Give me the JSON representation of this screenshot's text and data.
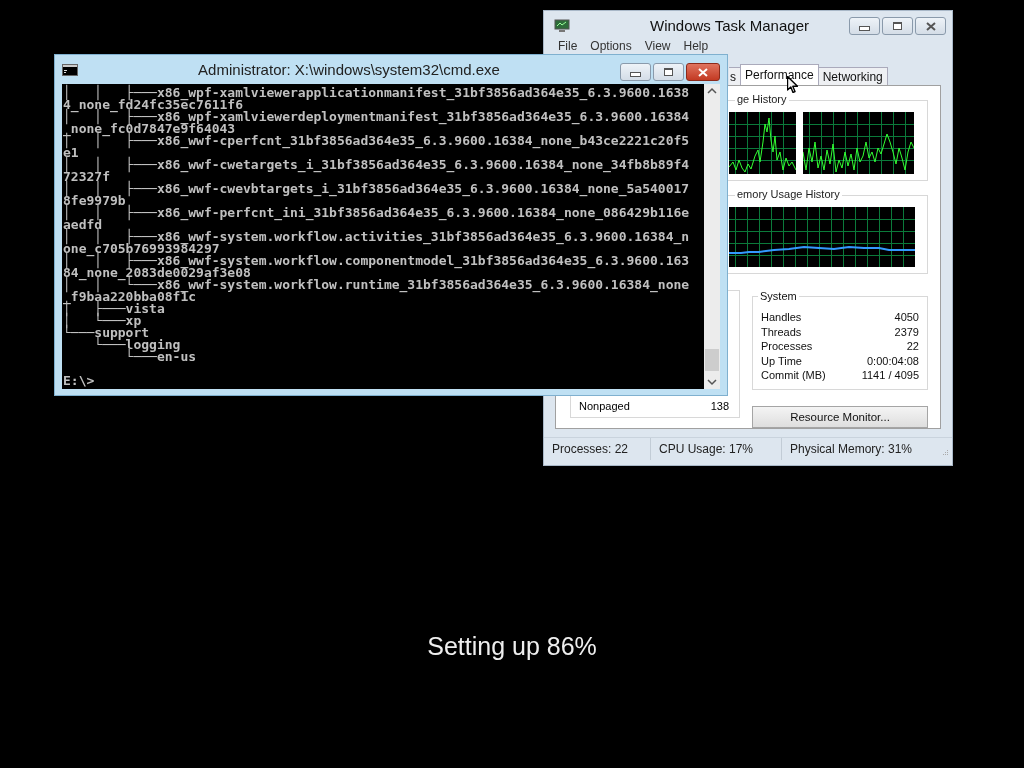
{
  "task_manager": {
    "title": "Windows Task Manager",
    "menu": [
      "File",
      "Options",
      "View",
      "Help"
    ],
    "tabs": [
      {
        "label": "s",
        "selected": false
      },
      {
        "label": "Performance",
        "selected": true
      },
      {
        "label": "Networking",
        "selected": false
      }
    ],
    "cpu_history": {
      "label": "ge History"
    },
    "memory_history": {
      "label": "emory Usage History"
    },
    "physical_memory": {
      "rows": [
        {
          "label": "Nonpaged",
          "value": "138"
        }
      ]
    },
    "system": {
      "title": "System",
      "rows": [
        {
          "label": "Handles",
          "value": "4050"
        },
        {
          "label": "Threads",
          "value": "2379"
        },
        {
          "label": "Processes",
          "value": "22"
        },
        {
          "label": "Up Time",
          "value": "0:00:04:08"
        },
        {
          "label": "Commit (MB)",
          "value": "1141 / 4095"
        }
      ]
    },
    "resource_monitor_button": "Resource Monitor...",
    "status_bar": [
      "Processes: 22",
      "CPU Usage: 17%",
      "Physical Memory: 31%"
    ]
  },
  "console": {
    "title": "Administrator: X:\\windows\\system32\\cmd.exe",
    "lines": [
      "│   │   ├───x86_wpf-xamlviewerapplicationmanifest_31bf3856ad364e35_6.3.9600.1638",
      "4_none_fd24fc35ec7611f6",
      "│   │   ├───x86_wpf-xamlviewerdeploymentmanifest_31bf3856ad364e35_6.3.9600.16384",
      "_none_fc0d7847e9f64043",
      "│   │   ├───x86_wwf-cperfcnt_31bf3856ad364e35_6.3.9600.16384_none_b43ce2221c20f5",
      "e1",
      "│   │   ├───x86_wwf-cwetargets_i_31bf3856ad364e35_6.3.9600.16384_none_34fb8b89f4",
      "72327f",
      "│   │   ├───x86_wwf-cwevbtargets_i_31bf3856ad364e35_6.3.9600.16384_none_5a540017",
      "8fe9979b",
      "│   │   ├───x86_wwf-perfcnt_ini_31bf3856ad364e35_6.3.9600.16384_none_086429b116e",
      "aedfd",
      "│   │   ├───x86_wwf-system.workflow.activities_31bf3856ad364e35_6.3.9600.16384_n",
      "one_c705b76993984297",
      "│   │   ├───x86_wwf-system.workflow.componentmodel_31bf3856ad364e35_6.3.9600.163",
      "84_none_2083de0029af3e08",
      "│   │   └───x86_wwf-system.workflow.runtime_31bf3856ad364e35_6.3.9600.16384_none",
      "_f9baa220bba08f1c",
      "│   ├───vista",
      "│   └───xp",
      "└───support",
      "    └───logging",
      "        └───en-us"
    ],
    "prompt": "E:\\>"
  },
  "desktop": {
    "status_text": "Setting up 86%"
  }
}
